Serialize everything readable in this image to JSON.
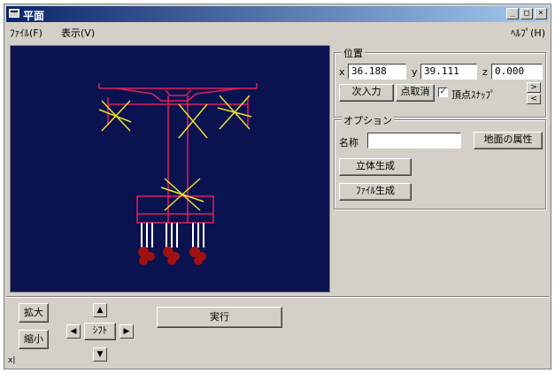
{
  "window": {
    "title": "平面"
  },
  "menu": {
    "file": "ﾌｧｲﾙ(F)",
    "view": "表示(V)",
    "help": "ﾍﾙﾌﾟ(H)"
  },
  "title_buttons": {
    "minimize": "_",
    "restore": "□",
    "close": "×"
  },
  "position": {
    "group_label": "位置",
    "x_label": "x",
    "x_value": "36.188",
    "y_label": "y",
    "y_value": "39.111",
    "z_label": "z",
    "z_value": "0.000",
    "input_button": "次入力",
    "cancel_button": "点取消",
    "snap_label": "頂点ｽﾅｯﾌﾟ",
    "snap_checked": true
  },
  "options": {
    "group_label": "オプション",
    "name_label": "名称",
    "name_value": "",
    "ground_attr_button": "地面の属性",
    "solid_button": "立体生成",
    "file_button": "ﾌｧｲﾙ生成"
  },
  "view_controls": {
    "zoom_in": "拡大",
    "zoom_out": "縮小",
    "shift_label": "ｼﾌﾄ",
    "execute": "実行"
  },
  "status": {
    "corner": "x|"
  },
  "colors": {
    "canvas": "#0a1250",
    "structure": "#e0205a",
    "braces": "#f0e030",
    "piles": "#ffffff",
    "pile_heads": "#a01010"
  }
}
